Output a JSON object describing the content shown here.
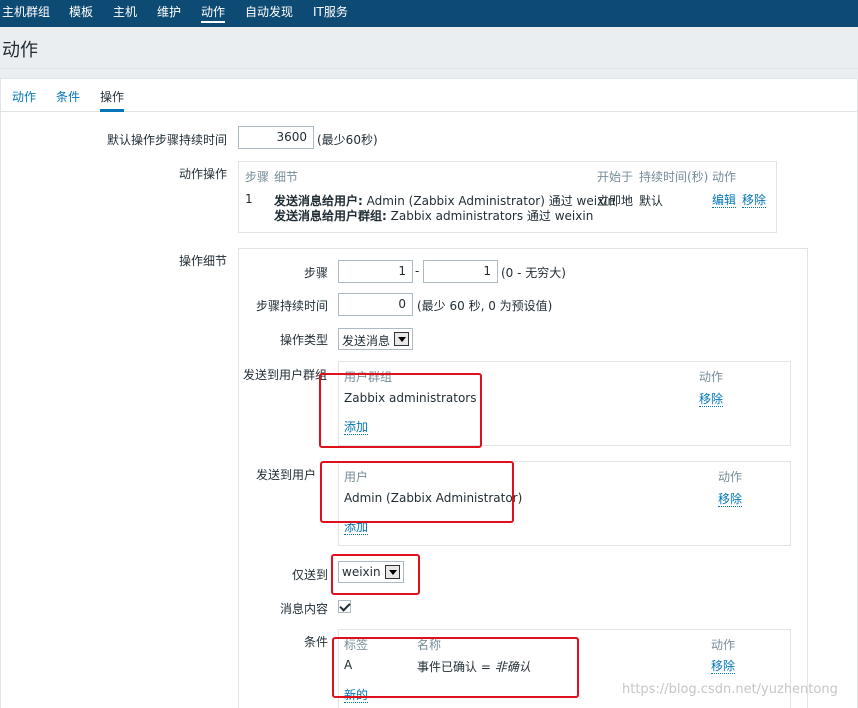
{
  "topnav": {
    "items": [
      "主机群组",
      "模板",
      "主机",
      "维护",
      "动作",
      "自动发现",
      "IT服务"
    ]
  },
  "header": {
    "title": "动作"
  },
  "tabs": [
    "动作",
    "条件",
    "操作"
  ],
  "form": {
    "default_step_duration_label": "默认操作步骤持续时间",
    "default_step_duration_value": "3600",
    "default_step_duration_hint": "(最少60秒)",
    "action_ops_label": "动作操作",
    "ops_table": {
      "headers": [
        "步骤",
        "细节",
        "开始于",
        "持续时间(秒)",
        "动作"
      ],
      "row": {
        "step": "1",
        "detail1_bold": "发送消息给用户:",
        "detail1_text": " Admin (Zabbix Administrator) 通过 weixin",
        "detail2_bold": "发送消息给用户群组:",
        "detail2_text": " Zabbix administrators 通过 weixin",
        "start": "立即地",
        "duration": "默认",
        "edit": "编辑",
        "remove": "移除"
      }
    },
    "op_details_label": "操作细节",
    "steps_label": "步骤",
    "step_from": "1",
    "step_sep": "-",
    "step_to": "1",
    "step_hint": "(0 - 无穷大)",
    "step_duration_label": "步骤持续时间",
    "step_duration_value": "0",
    "step_duration_hint": "(最少 60 秒, 0 为预设值)",
    "op_type_label": "操作类型",
    "op_type_value": "发送消息",
    "send_groups_label": "发送到用户群组",
    "groups_table": {
      "header_group": "用户群组",
      "header_action": "动作",
      "group": "Zabbix administrators",
      "remove": "移除",
      "add": "添加"
    },
    "send_users_label": "发送到用户",
    "users_table": {
      "header_user": "用户",
      "header_action": "动作",
      "user": "Admin (Zabbix Administrator)",
      "remove": "移除",
      "add": "添加"
    },
    "send_only_label": "仅送到",
    "send_only_value": "weixin",
    "msg_content_label": "消息内容",
    "cond_label": "条件",
    "cond_table": {
      "header_label": "标签",
      "header_name": "名称",
      "header_action": "动作",
      "row_label": "A",
      "row_name": "事件已确认 = ",
      "row_value": "非确认",
      "remove": "移除",
      "new": "新的"
    }
  },
  "watermark": "https://blog.csdn.net/yuzhentong"
}
